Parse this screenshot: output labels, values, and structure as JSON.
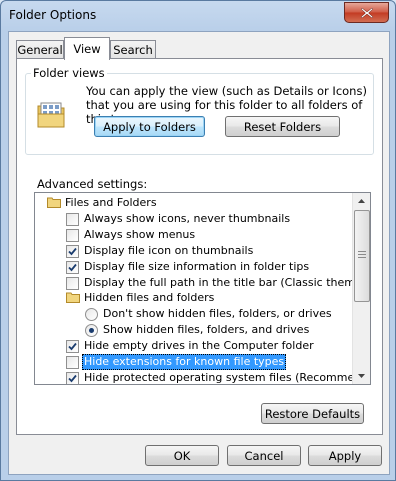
{
  "window": {
    "title": "Folder Options"
  },
  "tabs": [
    {
      "label": "General",
      "selected": false
    },
    {
      "label": "View",
      "selected": true
    },
    {
      "label": "Search",
      "selected": false
    }
  ],
  "folder_views": {
    "legend": "Folder views",
    "description": "You can apply the view (such as Details or Icons) that you are using for this folder to all folders of this type.",
    "apply_button": "Apply to Folders",
    "reset_button": "Reset Folders"
  },
  "advanced": {
    "label": "Advanced settings:",
    "items": [
      {
        "type": "folder",
        "label": "Files and Folders"
      },
      {
        "type": "checkbox",
        "label": "Always show icons, never thumbnails",
        "checked": false
      },
      {
        "type": "checkbox",
        "label": "Always show menus",
        "checked": false
      },
      {
        "type": "checkbox",
        "label": "Display file icon on thumbnails",
        "checked": true
      },
      {
        "type": "checkbox",
        "label": "Display file size information in folder tips",
        "checked": true
      },
      {
        "type": "checkbox",
        "label": "Display the full path in the title bar (Classic theme only)",
        "checked": false
      },
      {
        "type": "folder",
        "label": "Hidden files and folders"
      },
      {
        "type": "radio",
        "label": "Don't show hidden files, folders, or drives",
        "checked": false
      },
      {
        "type": "radio",
        "label": "Show hidden files, folders, and drives",
        "checked": true
      },
      {
        "type": "checkbox",
        "label": "Hide empty drives in the Computer folder",
        "checked": true
      },
      {
        "type": "checkbox",
        "label": "Hide extensions for known file types",
        "checked": false,
        "selected": true
      },
      {
        "type": "checkbox",
        "label": "Hide protected operating system files (Recommended)",
        "checked": true
      }
    ],
    "restore_button": "Restore Defaults"
  },
  "footer": {
    "ok": "OK",
    "cancel": "Cancel",
    "apply": "Apply"
  },
  "colors": {
    "selection": "#3399ff",
    "check": "#1a3c6e",
    "close": "#c23a22"
  },
  "icons": {
    "close": "close-icon",
    "folder": "folder-icon",
    "views": "folder-views-icon"
  }
}
